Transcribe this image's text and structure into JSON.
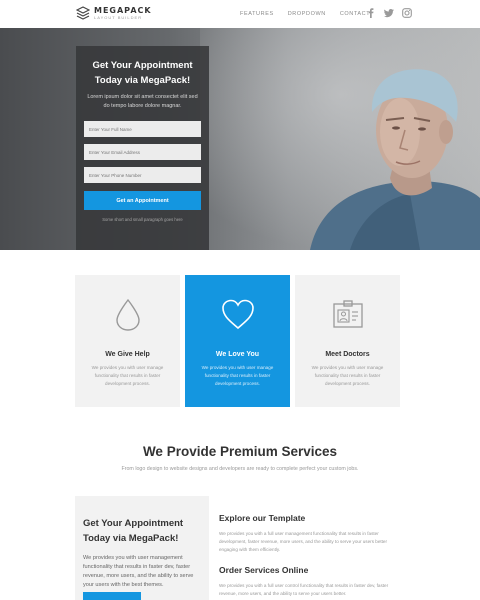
{
  "header": {
    "brand": "MEGAPACK",
    "brand_sub": "LAYOUT BUILDER",
    "nav": [
      "FEATURES",
      "DROPDOWN",
      "CONTACT"
    ],
    "social": [
      "facebook-icon",
      "twitter-icon",
      "instagram-icon"
    ]
  },
  "hero": {
    "title": "Get Your Appointment Today via MegaPack!",
    "description": "Lorem ipsum dolor sit amet consectet elit sed do tempo labore dolore magnar.",
    "fields": [
      {
        "placeholder": "Enter Your Full Name"
      },
      {
        "placeholder": "Enter Your Email Address"
      },
      {
        "placeholder": "Enter Your Phone Number"
      }
    ],
    "button": "Get an Appointment",
    "note": "Some short and small paragraph goes here"
  },
  "features": [
    {
      "icon": "drop-icon",
      "title": "We Give Help",
      "text": "We provides you with user manage functionality that results in faster development process."
    },
    {
      "icon": "heart-icon",
      "title": "We Love You",
      "text": "We provides you with user manage functionality that results in faster development process."
    },
    {
      "icon": "id-card-icon",
      "title": "Meet Doctors",
      "text": "We provides you with user manage functionality that results in faster development process."
    }
  ],
  "services": {
    "title": "We Provide Premium Services",
    "subtitle": "From logo design to website designs and developers are ready to complete perfect your custom jobs."
  },
  "appointment": {
    "title": "Get Your Appointment Today via MegaPack!",
    "text": "We provides you with user management functionality that results in faster dev, faster revenue, more users, and the ability to serve your users with the best themes."
  },
  "explore": {
    "title": "Explore our Template",
    "text": "We provides you with a full user management functionality that results in faster development, faster revenue, more users, and the ability to serve your users better engaging with them efficiently."
  },
  "order": {
    "title": "Order Services Online",
    "text": "We provides you with a full user control functionality that results in faster dev, faster revenue, more users, and the ability to serve your users better."
  },
  "colors": {
    "accent": "#1496e0",
    "card_bg": "#f2f2f2",
    "hero_overlay": "#37383a"
  }
}
